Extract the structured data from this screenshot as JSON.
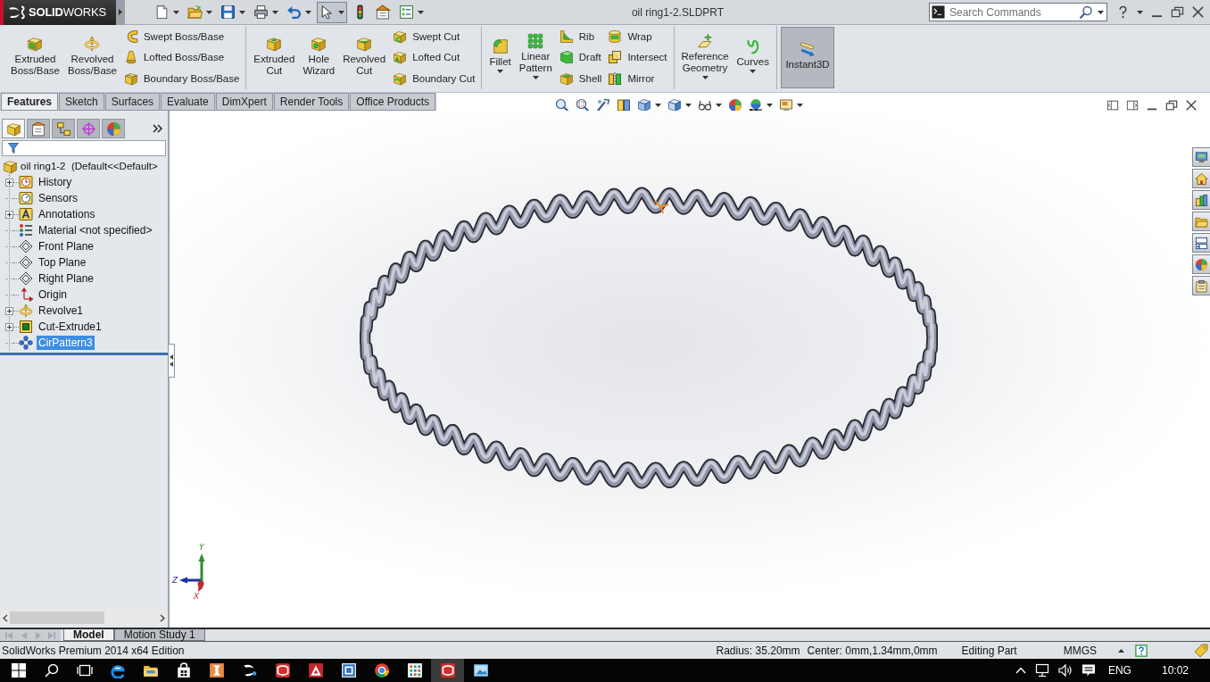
{
  "title_bar": {
    "logo": "**SOLID**WORKS",
    "quick_access": [
      {
        "selected": false,
        "dropdown": true
      },
      {
        "selected": false,
        "dropdown": true
      },
      {
        "selected": false,
        "dropdown": true
      },
      {
        "selected": false,
        "dropdown": true
      },
      {
        "selected": false,
        "dropdown": true
      },
      {
        "selected": true,
        "dropdown": true
      },
      {
        "selected": false,
        "dropdown": false
      },
      {
        "selected": false,
        "dropdown": false
      },
      {
        "selected": false,
        "dropdown": true
      }
    ],
    "document_title": "oil ring1-2.SLDPRT",
    "search": {
      "placeholder": "Search Commands"
    }
  },
  "command_manager": {
    "sections": [
      {
        "columns": [
          {
            "kind": "large",
            "label": "Extruded Boss/Base",
            "dropdown": false,
            "pressed": false
          },
          {
            "kind": "large",
            "label": "Revolved Boss/Base",
            "dropdown": false,
            "pressed": false
          },
          {
            "kind": "stack",
            "items": [
              {
                "label": "Swept Boss/Base"
              },
              {
                "label": "Lofted Boss/Base"
              },
              {
                "label": "Boundary Boss/Base"
              }
            ]
          }
        ]
      },
      {
        "columns": [
          {
            "kind": "large",
            "label": "Extruded Cut",
            "dropdown": false,
            "pressed": false
          },
          {
            "kind": "large",
            "label": "Hole Wizard",
            "dropdown": false,
            "pressed": false
          },
          {
            "kind": "large",
            "label": "Revolved Cut",
            "dropdown": false,
            "pressed": false
          },
          {
            "kind": "stack",
            "items": [
              {
                "label": "Swept Cut"
              },
              {
                "label": "Lofted Cut"
              },
              {
                "label": "Boundary Cut"
              }
            ]
          }
        ]
      },
      {
        "columns": [
          {
            "kind": "large",
            "label": "Fillet",
            "dropdown": true,
            "pressed": false
          },
          {
            "kind": "large",
            "label": "Linear Pattern",
            "dropdown": true,
            "pressed": false
          },
          {
            "kind": "stack",
            "items": [
              {
                "label": "Rib"
              },
              {
                "label": "Draft"
              },
              {
                "label": "Shell"
              }
            ]
          },
          {
            "kind": "stack",
            "items": [
              {
                "label": "Wrap"
              },
              {
                "label": "Intersect"
              },
              {
                "label": "Mirror"
              }
            ]
          }
        ]
      },
      {
        "columns": [
          {
            "kind": "large",
            "label": "Reference Geometry",
            "dropdown": true,
            "pressed": false
          },
          {
            "kind": "large",
            "label": "Curves",
            "dropdown": true,
            "pressed": false
          }
        ]
      },
      {
        "columns": [
          {
            "kind": "large",
            "label": "Instant3D",
            "dropdown": false,
            "pressed": true
          }
        ]
      }
    ],
    "tabs": [
      {
        "label": "Features",
        "selected": true
      },
      {
        "label": "Sketch",
        "selected": false
      },
      {
        "label": "Surfaces",
        "selected": false
      },
      {
        "label": "Evaluate",
        "selected": false
      },
      {
        "label": "DimXpert",
        "selected": false
      },
      {
        "label": "Render Tools",
        "selected": false
      },
      {
        "label": "Office Products",
        "selected": false
      }
    ]
  },
  "feature_manager": {
    "panel_tabs": [
      {
        "selected": true
      },
      {
        "selected": false
      },
      {
        "selected": false
      },
      {
        "selected": false
      },
      {
        "selected": false
      }
    ],
    "tree": {
      "root": "oil ring1-2  (Default<<Default>",
      "items": [
        {
          "label": "History",
          "expandable": true,
          "selected": false
        },
        {
          "label": "Sensors",
          "expandable": false,
          "selected": false
        },
        {
          "label": "Annotations",
          "expandable": true,
          "selected": false
        },
        {
          "label": "Material <not specified>",
          "expandable": false,
          "selected": false
        },
        {
          "label": "Front Plane",
          "expandable": false,
          "selected": false
        },
        {
          "label": "Top Plane",
          "expandable": false,
          "selected": false
        },
        {
          "label": "Right Plane",
          "expandable": false,
          "selected": false
        },
        {
          "label": "Origin",
          "expandable": false,
          "selected": false
        },
        {
          "label": "Revolve1",
          "expandable": true,
          "selected": false
        },
        {
          "label": "Cut-Extrude1",
          "expandable": true,
          "selected": false
        },
        {
          "label": "CirPattern3",
          "expandable": false,
          "selected": true
        }
      ]
    }
  },
  "graphics_area": {
    "triad": {
      "y": "Y",
      "z": "Z",
      "x": "X"
    }
  },
  "bottom_bar": {
    "nav_buttons": [
      {
        "disabled": true
      },
      {
        "disabled": true
      },
      {
        "disabled": true
      },
      {
        "disabled": true
      }
    ],
    "tabs": [
      {
        "label": "Model",
        "selected": true
      },
      {
        "label": "Motion Study 1",
        "selected": false
      }
    ]
  },
  "status_bar": {
    "edition": "SolidWorks Premium 2014 x64 Edition",
    "radius": "Radius: 35.20mm",
    "center": "Center: 0mm,1.34mm,0mm",
    "mode": "Editing Part",
    "units": "MMGS"
  },
  "taskbar": {
    "apps": [
      {
        "active": false
      },
      {
        "active": false
      },
      {
        "active": false
      },
      {
        "active": false
      },
      {
        "active": false
      },
      {
        "active": false
      },
      {
        "active": false
      },
      {
        "active": false
      },
      {
        "active": false
      },
      {
        "active": false
      },
      {
        "active": true
      },
      {
        "active": false
      }
    ],
    "language": "ENG",
    "clock": "10:02"
  }
}
